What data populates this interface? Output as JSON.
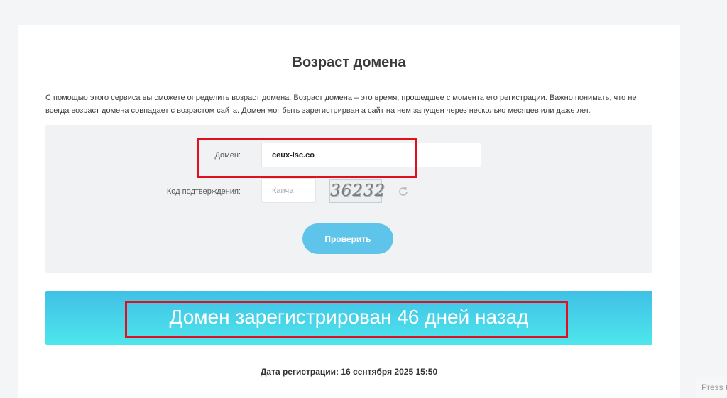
{
  "page": {
    "title": "Возраст домена",
    "description": "С помощью этого сервиса вы сможете определить возраст домена. Возраст домена – это время, прошедшее с момента его регистрации. Важно понимать, что не всегда возраст домена совпадает с возрастом сайта. Домен мог быть зарегистрирван а сайт на нем запущен через несколько месяцев или даже лет."
  },
  "form": {
    "domain_label": "Домен:",
    "domain_value": "ceux-isc.co",
    "captcha_label": "Код подтверждения:",
    "captcha_placeholder": "Капча",
    "captcha_code": "36232",
    "submit_label": "Проверить"
  },
  "result": {
    "message": "Домен зарегистрирован 46 дней назад",
    "registration_date": "Дата регистрации: 16 сентября 2025 15:50"
  },
  "overlay": {
    "press_text": "Press t"
  },
  "colors": {
    "accent": "#5fc4ea",
    "banner_top": "#40c0e6",
    "banner_bottom": "#4ee6ec",
    "highlight": "#e0101e"
  }
}
